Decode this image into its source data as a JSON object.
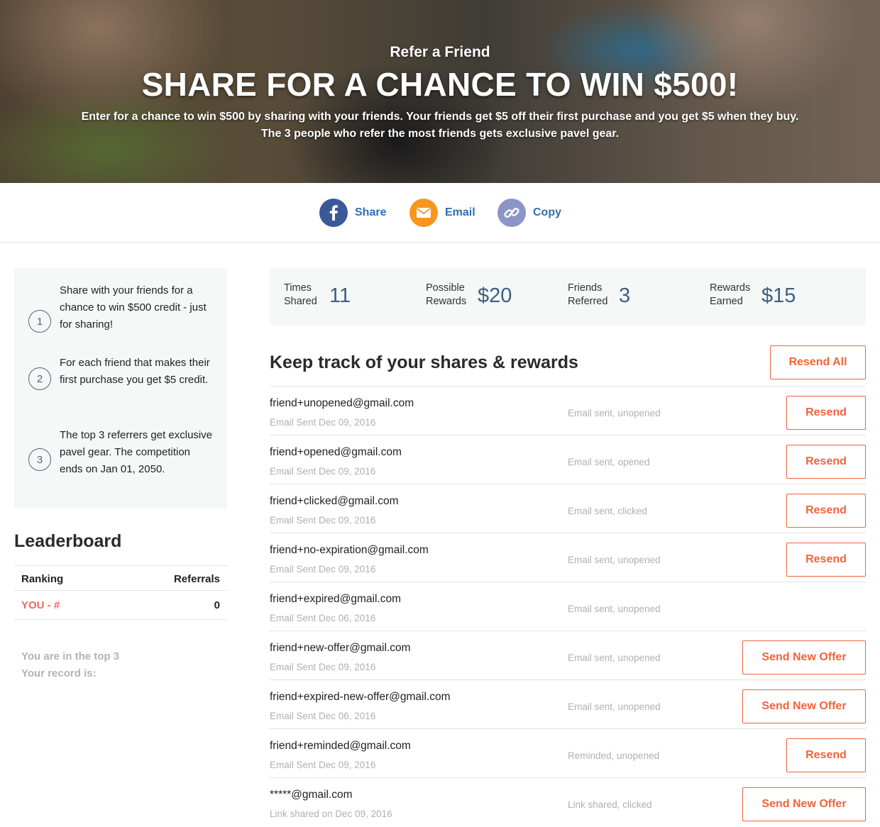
{
  "hero": {
    "eyebrow": "Refer a Friend",
    "title": "SHARE FOR A CHANCE TO WIN $500!",
    "description_line1": "Enter for a chance to win $500 by sharing with your friends. Your friends get $5 off their first purchase and you get $5 when they buy.",
    "description_line2": "The 3 people who refer the most friends gets exclusive pavel gear."
  },
  "share_bar": {
    "items": [
      {
        "label": "Share",
        "icon": "facebook-icon",
        "color": "#3b5998"
      },
      {
        "label": "Email",
        "icon": "envelope-icon",
        "color": "#f7961e"
      },
      {
        "label": "Copy",
        "icon": "link-icon",
        "color": "#8c95c8"
      }
    ]
  },
  "steps": [
    {
      "number": "1",
      "text": "Share with your friends for a chance to win $500 credit - just for sharing!"
    },
    {
      "number": "2",
      "text": "For each friend that makes their first purchase you get $5 credit."
    },
    {
      "number": "3",
      "text": "The top 3 referrers get exclusive pavel gear. The competition ends on Jan 01, 2050."
    }
  ],
  "leaderboard": {
    "title": "Leaderboard",
    "col_ranking": "Ranking",
    "col_referrals": "Referrals",
    "you_label": "YOU - #",
    "you_referrals": "0",
    "note_line1": "You are in the top 3",
    "note_line2": "Your record is:"
  },
  "stats": [
    {
      "label_line1": "Times",
      "label_line2": "Shared",
      "value": "11"
    },
    {
      "label_line1": "Possible",
      "label_line2": "Rewards",
      "value": "$20"
    },
    {
      "label_line1": "Friends",
      "label_line2": "Referred",
      "value": "3"
    },
    {
      "label_line1": "Rewards",
      "label_line2": "Earned",
      "value": "$15"
    }
  ],
  "tracking": {
    "title": "Keep track of your shares & rewards",
    "resend_all_label": "Resend All",
    "rows": [
      {
        "email": "friend+unopened@gmail.com",
        "date": "Email Sent Dec 09, 2016",
        "status": "Email sent, unopened",
        "action": "Resend"
      },
      {
        "email": "friend+opened@gmail.com",
        "date": "Email Sent Dec 09, 2016",
        "status": "Email sent, opened",
        "action": "Resend"
      },
      {
        "email": "friend+clicked@gmail.com",
        "date": "Email Sent Dec 09, 2016",
        "status": "Email sent, clicked",
        "action": "Resend"
      },
      {
        "email": "friend+no-expiration@gmail.com",
        "date": "Email Sent Dec 09, 2016",
        "status": "Email sent, unopened",
        "action": "Resend"
      },
      {
        "email": "friend+expired@gmail.com",
        "date": "Email Sent Dec 06, 2016",
        "status": "Email sent, unopened",
        "action": ""
      },
      {
        "email": "friend+new-offer@gmail.com",
        "date": "Email Sent Dec 09, 2016",
        "status": "Email sent, unopened",
        "action": "Send New Offer"
      },
      {
        "email": "friend+expired-new-offer@gmail.com",
        "date": "Email Sent Dec 06, 2016",
        "status": "Email sent, unopened",
        "action": "Send New Offer"
      },
      {
        "email": "friend+reminded@gmail.com",
        "date": "Email Sent Dec 09, 2016",
        "status": "Reminded, unopened",
        "action": "Resend"
      },
      {
        "email": "*****@gmail.com",
        "date": "Link shared on Dec 09, 2016",
        "status": "Link shared, clicked",
        "action": "Send New Offer"
      }
    ]
  },
  "colors": {
    "accent": "#f0643c",
    "stat_value": "#3e5f7f",
    "link": "#2f6fb0",
    "you": "#ea6b59"
  }
}
